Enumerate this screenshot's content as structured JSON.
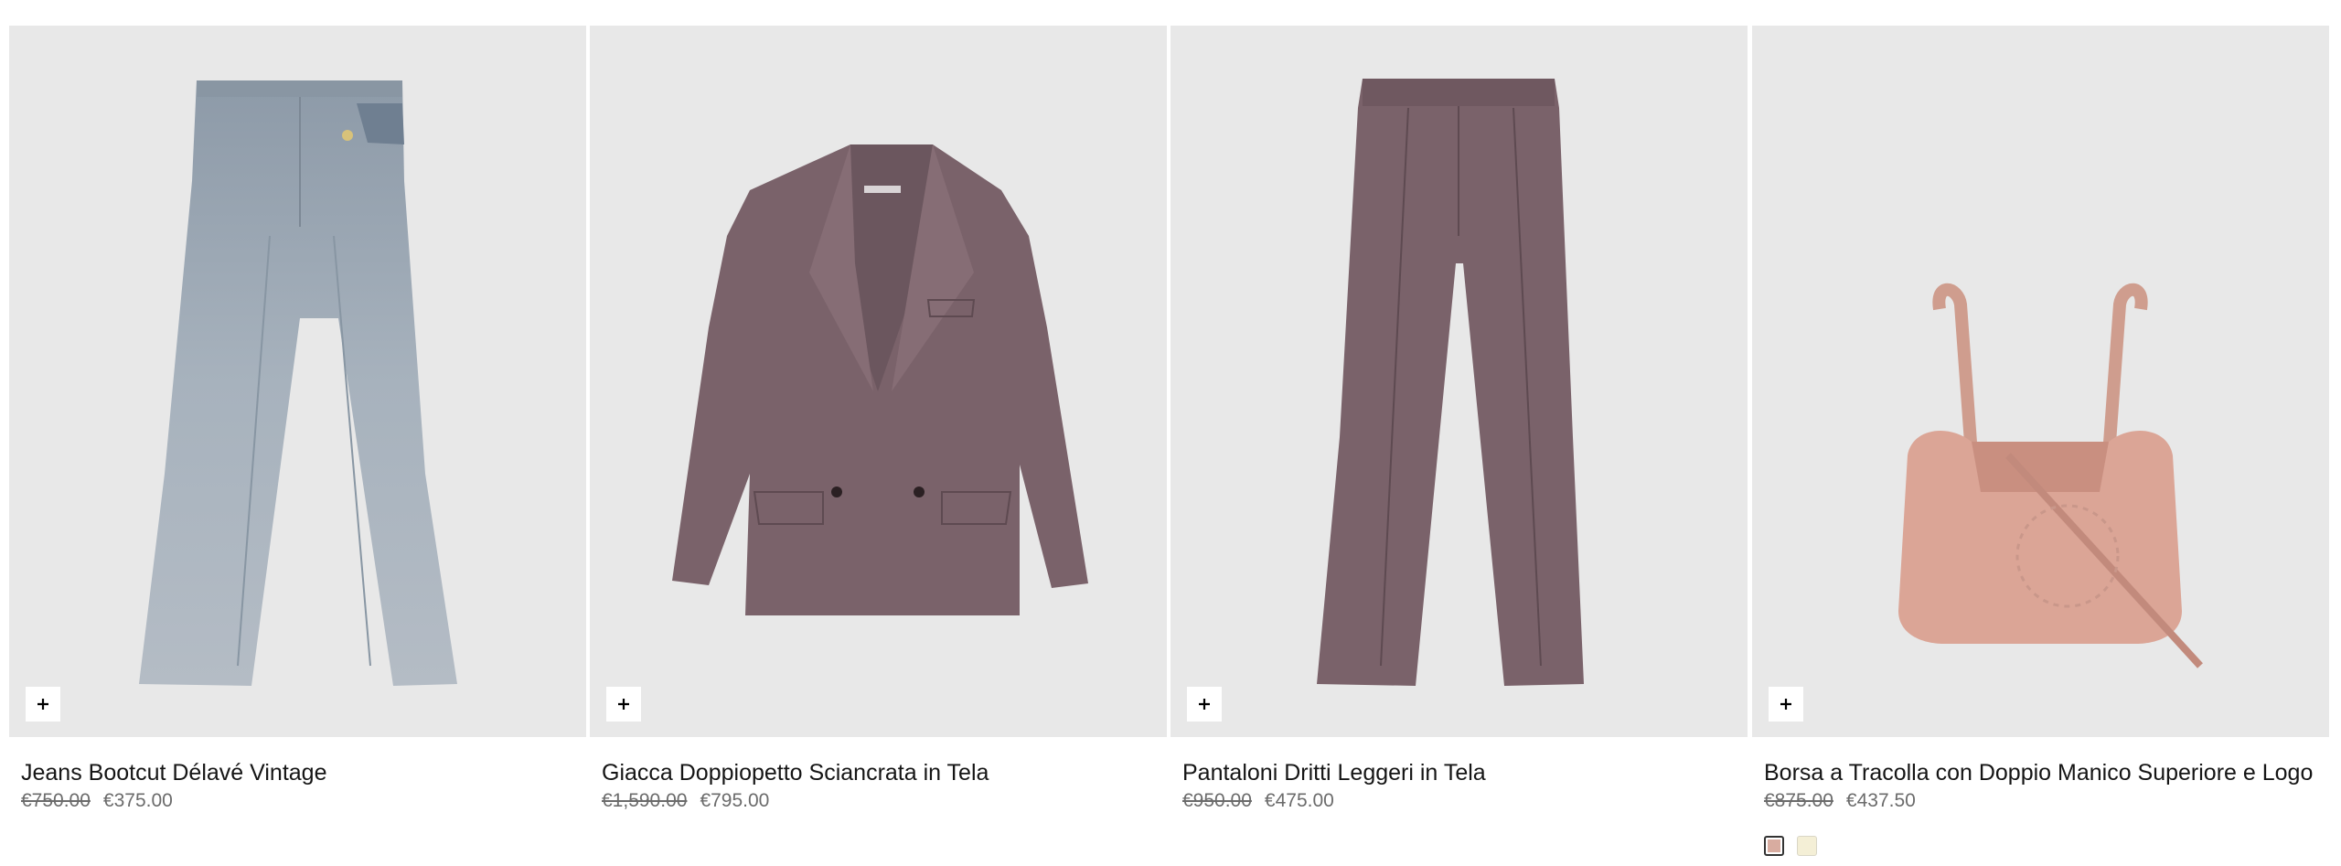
{
  "products": [
    {
      "name": "Jeans Bootcut Délavé Vintage",
      "price_old": "€750.00",
      "price_new": "€375.00",
      "add_label": "+"
    },
    {
      "name": "Giacca Doppiopetto Sciancrata in Tela",
      "price_old": "€1,590.00",
      "price_new": "€795.00",
      "add_label": "+"
    },
    {
      "name": "Pantaloni Dritti Leggeri in Tela",
      "price_old": "€950.00",
      "price_new": "€475.00",
      "add_label": "+"
    },
    {
      "name": "Borsa a Tracolla con Doppio Manico Superiore e Logo",
      "price_old": "€875.00",
      "price_new": "€437.50",
      "add_label": "+",
      "swatches": [
        {
          "color": "#d8aca0",
          "selected": true
        },
        {
          "color": "#f4efd6",
          "selected": false
        }
      ]
    }
  ],
  "icons": {
    "add": "plus-icon"
  },
  "colors": {
    "tile_background": "#e8e8e8",
    "text": "#151515",
    "price": "#6b6b6b"
  }
}
